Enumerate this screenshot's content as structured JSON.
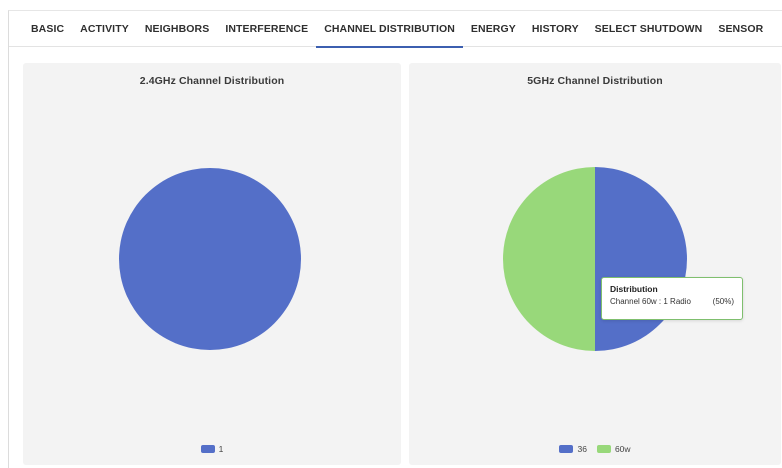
{
  "tabs": [
    {
      "label": "BASIC",
      "active": false
    },
    {
      "label": "ACTIVITY",
      "active": false
    },
    {
      "label": "NEIGHBORS",
      "active": false
    },
    {
      "label": "INTERFERENCE",
      "active": false
    },
    {
      "label": "CHANNEL DISTRIBUTION",
      "active": true
    },
    {
      "label": "ENERGY",
      "active": false
    },
    {
      "label": "HISTORY",
      "active": false
    },
    {
      "label": "SELECT SHUTDOWN",
      "active": false
    },
    {
      "label": "SENSOR",
      "active": false
    }
  ],
  "colors": {
    "blue": "#546fc8",
    "green": "#98d87a",
    "active_tab": "#3c5fb0"
  },
  "chart_data": [
    {
      "type": "pie",
      "title": "2.4GHz Channel Distribution",
      "slices": [
        {
          "label": "1",
          "value": 1,
          "color": "#546fc8"
        }
      ],
      "legend_placement": "bottom"
    },
    {
      "type": "pie",
      "title": "5GHz Channel Distribution",
      "slices": [
        {
          "label": "36",
          "value": 1,
          "color": "#546fc8"
        },
        {
          "label": "60w",
          "value": 1,
          "color": "#98d87a"
        }
      ],
      "legend_placement": "bottom",
      "tooltip": {
        "title": "Distribution",
        "text": "Channel 60w : 1 Radio",
        "percent": "(50%)"
      }
    }
  ]
}
